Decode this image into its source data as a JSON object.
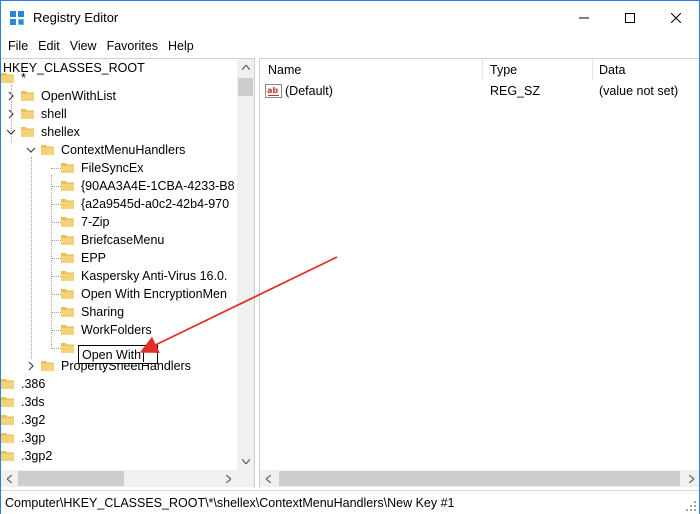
{
  "window": {
    "title": "Registry Editor",
    "accent": "#2b7dd6"
  },
  "menu": {
    "items": [
      "File",
      "Edit",
      "View",
      "Favorites",
      "Help"
    ]
  },
  "tree": {
    "root": "HKEY_CLASSES_ROOT",
    "items": [
      {
        "label": "*",
        "expander": "none"
      },
      {
        "label": "OpenWithList",
        "expander": "collapsed"
      },
      {
        "label": "shell",
        "expander": "collapsed"
      },
      {
        "label": "shellex",
        "expander": "expanded"
      },
      {
        "label": "ContextMenuHandlers",
        "expander": "expanded"
      },
      {
        "label": "FileSyncEx",
        "expander": "none"
      },
      {
        "label": "{90AA3A4E-1CBA-4233-B8",
        "expander": "none"
      },
      {
        "label": "{a2a9545d-a0c2-42b4-970",
        "expander": "none"
      },
      {
        "label": "7-Zip",
        "expander": "none"
      },
      {
        "label": "BriefcaseMenu",
        "expander": "none"
      },
      {
        "label": "EPP",
        "expander": "none"
      },
      {
        "label": "Kaspersky Anti-Virus 16.0.",
        "expander": "none"
      },
      {
        "label": "Open With EncryptionMen",
        "expander": "none"
      },
      {
        "label": "Sharing",
        "expander": "none"
      },
      {
        "label": "WorkFolders",
        "expander": "none"
      },
      {
        "label": "Open With",
        "expander": "none"
      },
      {
        "label": "PropertySheetHandlers",
        "expander": "collapsed"
      },
      {
        "label": ".386",
        "expander": "none"
      },
      {
        "label": ".3ds",
        "expander": "none"
      },
      {
        "label": ".3g2",
        "expander": "none"
      },
      {
        "label": ".3gp",
        "expander": "none"
      },
      {
        "label": ".3gp2",
        "expander": "none"
      }
    ],
    "editing_value": "Open With"
  },
  "list": {
    "columns": [
      "Name",
      "Type",
      "Data"
    ],
    "rows": [
      {
        "name": "(Default)",
        "type": "REG_SZ",
        "data": "(value not set)",
        "icon": "reg-string-icon"
      }
    ]
  },
  "status": {
    "path": "Computer\\HKEY_CLASSES_ROOT\\*\\shellex\\ContextMenuHandlers\\New Key #1"
  },
  "colors": {
    "folder": "#e8c15a",
    "arrow": "#e0302a"
  }
}
